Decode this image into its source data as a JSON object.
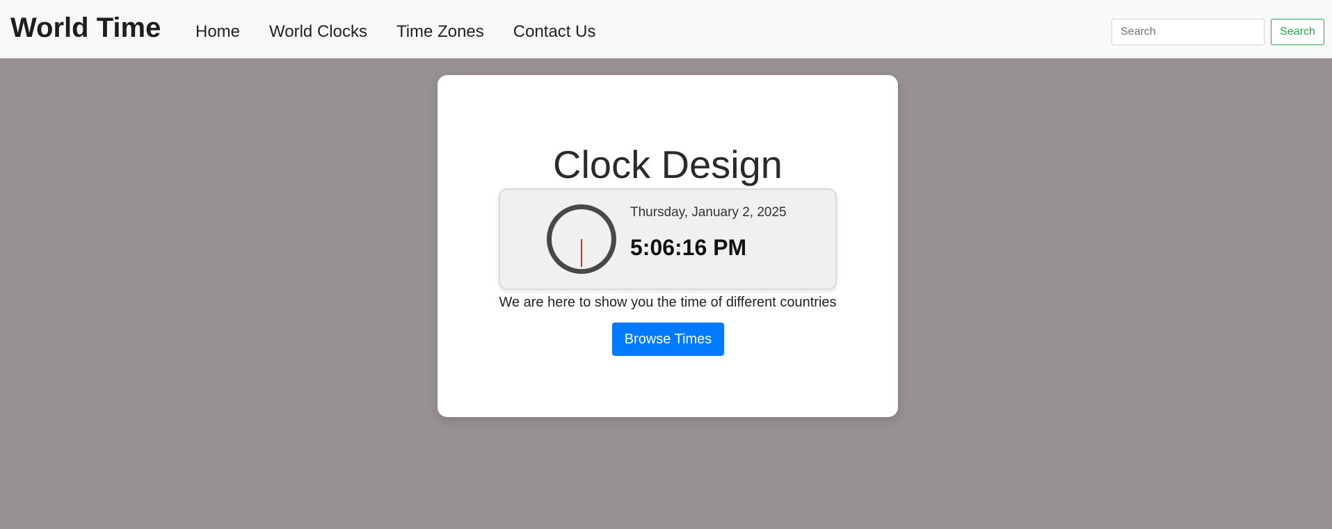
{
  "navbar": {
    "brand": "World Time",
    "links": [
      {
        "label": "Home"
      },
      {
        "label": "World Clocks"
      },
      {
        "label": "Time Zones"
      },
      {
        "label": "Contact Us"
      }
    ],
    "search": {
      "placeholder": "Search",
      "value": "",
      "button_label": "Search"
    }
  },
  "card": {
    "title": "Clock Design",
    "clock": {
      "date": "Thursday, January 2, 2025",
      "time": "5:06:16 PM"
    },
    "tagline": "We are here to show you the time of different countries",
    "cta_label": "Browse Times"
  },
  "colors": {
    "page_background": "#979191",
    "navbar_background": "#f8f9fa",
    "primary_button": "#007bff",
    "search_button": "#28a745",
    "clock_ring": "#484848",
    "clock_hand": "#c0392b"
  }
}
